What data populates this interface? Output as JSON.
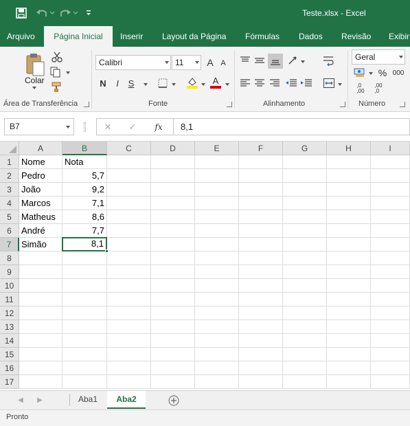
{
  "window": {
    "title": "Teste.xlsx - Excel"
  },
  "qat": {
    "save_icon": "save-icon",
    "undo_icon": "undo-icon",
    "redo_icon": "redo-icon",
    "customize_icon": "customize-qat-icon"
  },
  "tabs": [
    {
      "label": "Arquivo"
    },
    {
      "label": "Página Inicial",
      "active": true
    },
    {
      "label": "Inserir"
    },
    {
      "label": "Layout da Página"
    },
    {
      "label": "Fórmulas"
    },
    {
      "label": "Dados"
    },
    {
      "label": "Revisão"
    },
    {
      "label": "Exibir"
    }
  ],
  "ribbon": {
    "clipboard": {
      "label": "Área de Transferência",
      "paste_label": "Colar"
    },
    "font": {
      "label": "Fonte",
      "font_name": "Calibri",
      "font_size": "11",
      "bold": "N",
      "italic": "I",
      "underline": "S",
      "grow": "A",
      "shrink": "A",
      "font_color_glyph": "A"
    },
    "alignment": {
      "label": "Alinhamento"
    },
    "number": {
      "label": "Número",
      "format": "Geral",
      "percent": "%",
      "thousands": "000",
      "inc_decimal": ",0\n,00",
      "dec_decimal": ",00\n,0"
    }
  },
  "formula_bar": {
    "name_box": "B7",
    "cancel_glyph": "✕",
    "enter_glyph": "✓",
    "fx_glyph": "fx",
    "value": "8,1"
  },
  "sheet": {
    "columns": [
      "A",
      "B",
      "C",
      "D",
      "E",
      "F",
      "G",
      "H",
      "I"
    ],
    "selected_column": "B",
    "selected_row": 7,
    "row_numbers": [
      1,
      2,
      3,
      4,
      5,
      6,
      7,
      8,
      9,
      10,
      11,
      12,
      13,
      14,
      15,
      16,
      17
    ],
    "cells": {
      "A1": "Nome",
      "B1": "Nota",
      "A2": "Pedro",
      "B2": "5,7",
      "A3": "João",
      "B3": "9,2",
      "A4": "Marcos",
      "B4": "7,1",
      "A5": "Matheus",
      "B5": "8,6",
      "A6": "André",
      "B6": "7,7",
      "A7": "Simão",
      "B7": "8,1"
    },
    "active_cell": "B7"
  },
  "sheet_tabs": [
    {
      "label": "Aba1"
    },
    {
      "label": "Aba2",
      "active": true
    }
  ],
  "status": {
    "text": "Pronto"
  },
  "colors": {
    "brand": "#217346",
    "ribbon_bg": "#f3f3f3",
    "font_color_bar": "#e00000",
    "highlight_bar": "#ffee00"
  }
}
